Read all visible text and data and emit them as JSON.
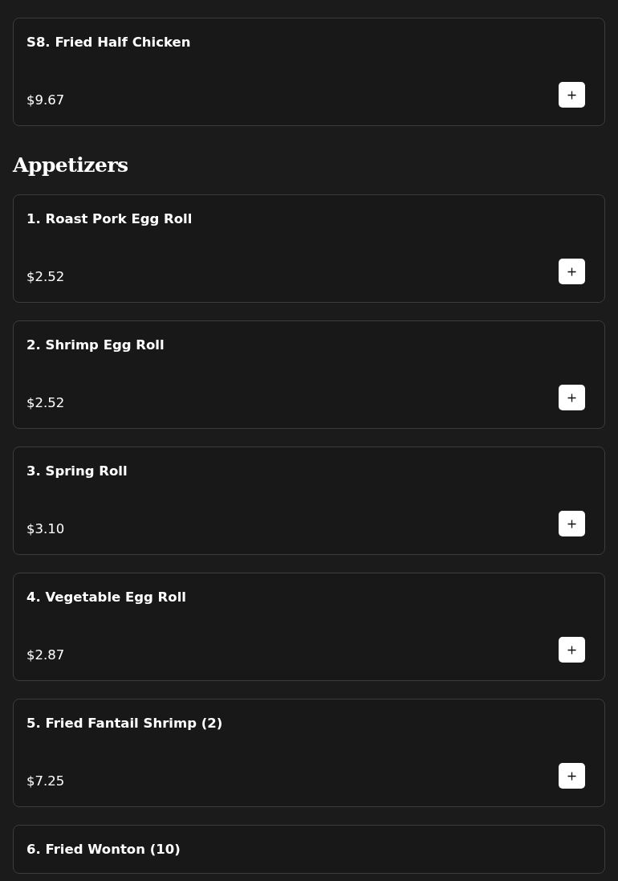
{
  "sections": [
    {
      "items": [
        {
          "name": "S8. Fried Half Chicken",
          "price": "$9.67"
        }
      ]
    },
    {
      "title": "Appetizers",
      "items": [
        {
          "name": "1. Roast Pork Egg Roll",
          "price": "$2.52"
        },
        {
          "name": "2. Shrimp Egg Roll",
          "price": "$2.52"
        },
        {
          "name": "3. Spring Roll",
          "price": "$3.10"
        },
        {
          "name": "4. Vegetable Egg Roll",
          "price": "$2.87"
        },
        {
          "name": "5. Fried Fantail Shrimp (2)",
          "price": "$7.25"
        },
        {
          "name": "6. Fried Wonton (10)"
        }
      ]
    }
  ]
}
